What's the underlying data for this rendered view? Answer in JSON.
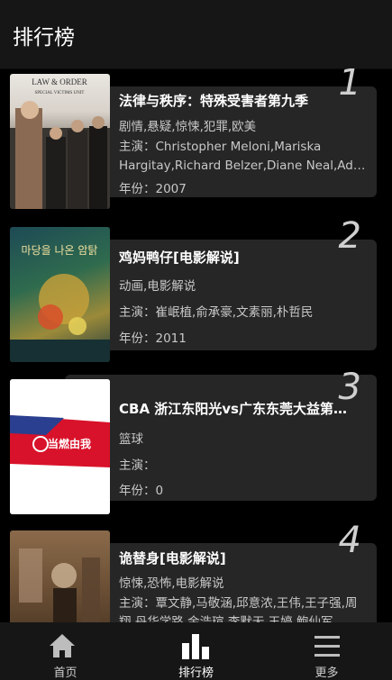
{
  "header": {
    "title": "排行榜"
  },
  "items": [
    {
      "rank": "1",
      "title": "法律与秩序：特殊受害者第九季",
      "genre": "剧情,悬疑,惊悚,犯罪,欧美",
      "cast_line1": "主演：Christopher Meloni,Mariska",
      "cast_line2": "Hargitay,Richard Belzer,Diane Neal,Adam ...",
      "year": "年份：2007",
      "poster_text": "LAW & ORDER",
      "poster_subtext": "SPECIAL VICTIMS UNIT"
    },
    {
      "rank": "2",
      "title": "鸡妈鸭仔[电影解说]",
      "genre": "动画,电影解说",
      "cast": "主演：崔岷植,俞承豪,文素丽,朴哲民",
      "year": "年份：2011",
      "poster_text": "마당을 나온 암탉"
    },
    {
      "rank": "3",
      "title": "CBA 浙江东阳光vs广东东莞大益第一节",
      "genre": "篮球",
      "cast": "主演：",
      "year": "年份：0",
      "poster_text": "当燃由我"
    },
    {
      "rank": "4",
      "title": "诡替身[电影解说]",
      "genre": "惊悚,恐怖,电影解说",
      "cast_line1": "主演：覃文静,马敬涵,邱意浓,王伟,王子强,周",
      "cast_line2": "翔,丹华学路,金浩瑄,李默无,王婷,鲍仙军"
    }
  ],
  "tabs": [
    {
      "label": "首页",
      "icon": "home-icon"
    },
    {
      "label": "排行榜",
      "icon": "bar-chart-icon",
      "active": true
    },
    {
      "label": "更多",
      "icon": "menu-icon"
    }
  ]
}
